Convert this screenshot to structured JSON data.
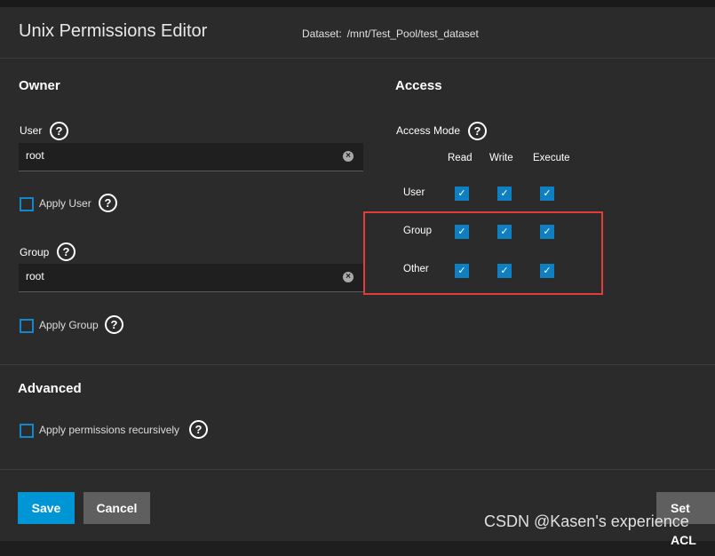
{
  "header": {
    "title": "Unix Permissions Editor",
    "dataset_label": "Dataset:",
    "dataset_path": "/mnt/Test_Pool/test_dataset"
  },
  "owner": {
    "heading": "Owner",
    "user_label": "User",
    "user_value": "root",
    "apply_user_label": "Apply User",
    "group_label": "Group",
    "group_value": "root",
    "apply_group_label": "Apply Group"
  },
  "access": {
    "heading": "Access",
    "mode_label": "Access Mode",
    "columns": [
      "Read",
      "Write",
      "Execute"
    ],
    "rows": [
      {
        "label": "User",
        "read": true,
        "write": true,
        "execute": true
      },
      {
        "label": "Group",
        "read": true,
        "write": true,
        "execute": true
      },
      {
        "label": "Other",
        "read": true,
        "write": true,
        "execute": true
      }
    ]
  },
  "advanced": {
    "heading": "Advanced",
    "recursive_label": "Apply permissions recursively"
  },
  "buttons": {
    "save": "Save",
    "cancel": "Cancel",
    "set_acl": "Set ACL"
  },
  "icons": {
    "help": "?",
    "clear": "×",
    "check": "✓"
  },
  "watermark": "CSDN @Kasen's experience",
  "colors": {
    "accent": "#0095d5",
    "checkbox": "#0e7fc1",
    "highlight": "#e23b3b"
  }
}
